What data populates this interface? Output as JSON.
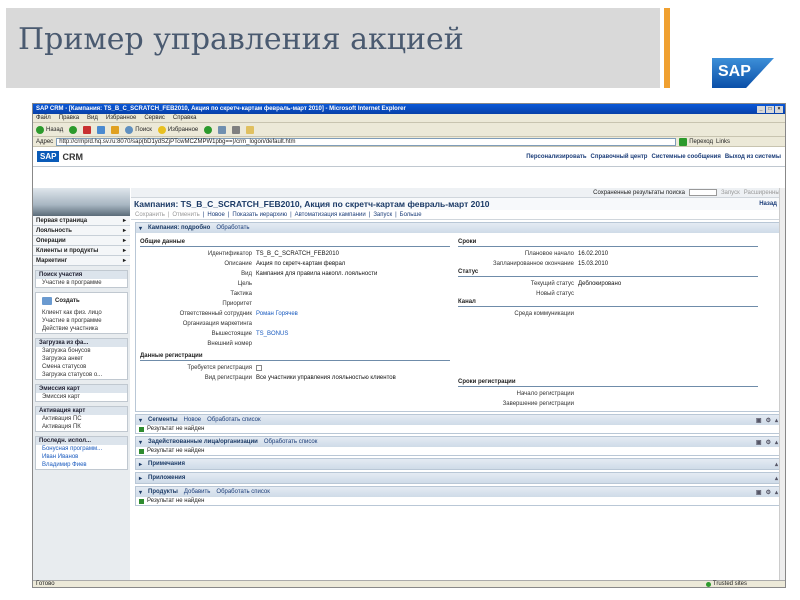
{
  "slide": {
    "title": "Пример управления акцией",
    "logo": "SAP"
  },
  "window": {
    "title": "SAP CRM - [Кампания: TS_B_C_SCRATCH_FEB2010, Акция по скретч-картам февраль-март 2010] - Microsoft Internet Explorer",
    "menu": [
      "Файл",
      "Правка",
      "Вид",
      "Избранное",
      "Сервис",
      "Справка"
    ],
    "toolbar": {
      "back": "Назад",
      "search": "Поиск",
      "favorites": "Избранное"
    },
    "address_label": "Адрес",
    "address": "http://crmprd.hq.sv.ru:8070/sap(bD1ydSZjPTcwMCZMPW1pbg==)/crm_logon/default.htm",
    "go": "Переход",
    "links": "Links",
    "status_left": "Готово",
    "status_right": "Trusted sites"
  },
  "crm": {
    "logo_sap": "SAP",
    "logo_crm": "CRM",
    "header_links": [
      "Персонализировать",
      "Справочный центр",
      "Системные сообщения",
      "Выход из системы"
    ],
    "saved_results": "Сохраненные результаты поиска",
    "start": "Запуск",
    "extended": "Расширенный"
  },
  "nav": {
    "items": [
      "Первая страница",
      "Лояльность",
      "Операции",
      "Клиенты и продукты",
      "Маркетинг"
    ],
    "search_hdr": "Поиск участия",
    "search_items": [
      "Участие в программе"
    ],
    "create_label": "Создать",
    "create_items": [
      "Клиент как физ. лицо",
      "Участие в программе",
      "Действие участника"
    ],
    "upload_hdr": "Загрузка из фа...",
    "upload_items": [
      "Загрузка бонусов",
      "Загрузка анкет",
      "Смена статусов",
      "Загрузка статусов о..."
    ],
    "issue_hdr": "Эмиссия карт",
    "issue_items": [
      "Эмиссия карт"
    ],
    "activation_hdr": "Активация карт",
    "activation_items": [
      "Активация ПС",
      "Активация ПК"
    ],
    "recent_hdr": "Последн. испол...",
    "recent_items": [
      "Бонусная программ...",
      "Иван Иванов",
      "Владимир Фиев"
    ]
  },
  "page": {
    "title": "Кампания: TS_B_C_SCRATCH_FEB2010, Акция по скретч-картам февраль-март 2010",
    "back": "Назад",
    "actions": [
      "Сохранить",
      "Отменить",
      "Новое",
      "Показать иерархию",
      "Автоматизация кампании",
      "Запуск",
      "Больше"
    ]
  },
  "details": {
    "header": "Кампания: подробно",
    "edit": "Обработать",
    "general_hdr": "Общие данные",
    "fields": [
      {
        "label": "Идентификатор",
        "value": "TS_B_C_SCRATCH_FEB2010"
      },
      {
        "label": "Описание",
        "value": "Акция по скретч-картам феврал"
      },
      {
        "label": "Вид",
        "value": "Кампания для правила накопл. лояльности"
      },
      {
        "label": "Цель",
        "value": ""
      },
      {
        "label": "Тактика",
        "value": ""
      },
      {
        "label": "Приоритет",
        "value": ""
      },
      {
        "label": "Ответственный сотрудник",
        "value": "Роман Горячев"
      },
      {
        "label": "Организация маркетинга",
        "value": ""
      },
      {
        "label": "Вышестоящие",
        "value": "TS_BONUS"
      },
      {
        "label": "Внешний номер",
        "value": ""
      }
    ],
    "reg_hdr": "Данные регистрации",
    "reg_required": "Требуется регистрация",
    "reg_type_label": "Вид регистрации",
    "reg_type_value": "Все участники управления лояльностью клиентов",
    "dates_hdr": "Сроки",
    "planned_start_label": "Плановое начало",
    "planned_start": "16.02.2010",
    "planned_end_label": "Запланированное окончание",
    "planned_end": "15.03.2010",
    "status_hdr": "Статус",
    "current_status_label": "Текущий статус",
    "current_status": "Деблокировано",
    "new_status_label": "Новый статус",
    "channel_hdr": "Канал",
    "channel_label": "Среда коммуникации",
    "reg_dates_hdr": "Сроки регистрации",
    "reg_start_label": "Начало регистрации",
    "reg_end_label": "Завершение регистрации"
  },
  "segments": {
    "header": "Сегменты",
    "new": "Новое",
    "edit_list": "Обработать список",
    "result": "Результат не найден"
  },
  "involved": {
    "header": "Задействованные лица/организации",
    "edit_list": "Обработать список",
    "result": "Результат не найден"
  },
  "notes": {
    "header": "Примечания"
  },
  "attachments": {
    "header": "Приложения"
  },
  "products": {
    "header": "Продукты",
    "add": "Добавить",
    "edit_list": "Обработать список",
    "result": "Результат не найден"
  }
}
